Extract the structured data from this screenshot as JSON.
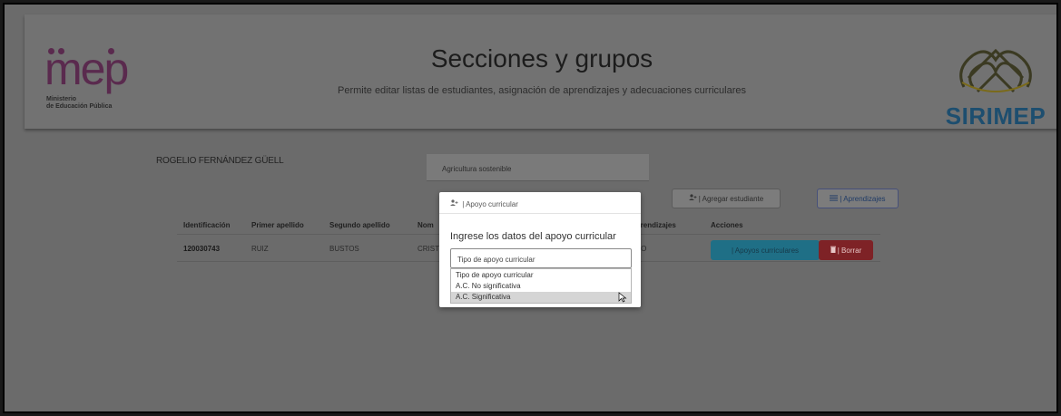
{
  "header": {
    "title": "Secciones y grupos",
    "subtitle": "Permite editar listas de estudiantes, asignación de aprendizajes y adecuaciones curriculares",
    "mep_logo": {
      "word": "mep",
      "line1": "Ministerio",
      "line2": "de Educación Pública"
    },
    "sirimep_logo": {
      "word": "SIRIMEP"
    }
  },
  "context": {
    "user_name": "ROGELIO FERNÁNDEZ GÜELL",
    "course": "Agricultura sostenible"
  },
  "toolbar": {
    "add_student_icon": "person-add-icon",
    "add_student_label": "| Agregar estudiante",
    "learnings_icon": "list-icon",
    "learnings_label": "| Aprendizajes"
  },
  "table": {
    "columns": [
      "Identificación",
      "Primer apellido",
      "Segundo apellido",
      "Nom",
      "Aprendizajes",
      "Acciones"
    ],
    "rows": [
      {
        "id": "120030743",
        "first_surname": "RUIZ",
        "second_surname": "BUSTOS",
        "name": "CRIST",
        "learnings": "AÑO",
        "actions": {
          "apoyos_label": "| Apoyos curriculares",
          "borrar_label": "| Borrar"
        }
      }
    ]
  },
  "modal": {
    "header_icon": "person-add-icon",
    "header_label": "| Apoyo curricular",
    "prompt": "Ingrese los datos del apoyo curricular",
    "select_value": "Tipo de apoyo curricular",
    "options": [
      "Tipo de apoyo curricular",
      "A.C. No significativa",
      "A.C. Significativa"
    ],
    "highlighted_option": "A.C. Significativa"
  }
}
